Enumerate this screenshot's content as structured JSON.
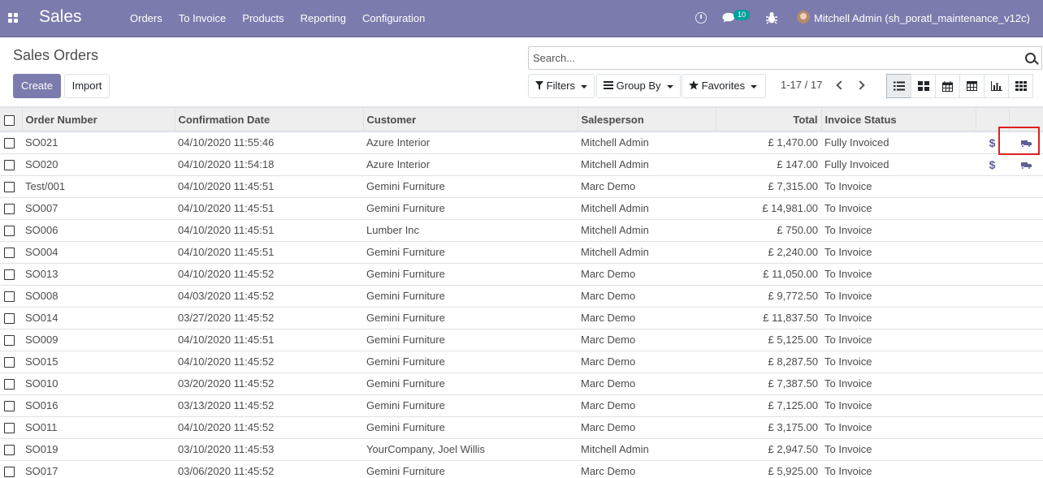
{
  "navbar": {
    "brand": "Sales",
    "menu": [
      "Orders",
      "To Invoice",
      "Products",
      "Reporting",
      "Configuration"
    ],
    "messages_count": "10",
    "user": "Mitchell Admin (sh_poratl_maintenance_v12c)"
  },
  "control_panel": {
    "title": "Sales Orders",
    "create_label": "Create",
    "import_label": "Import",
    "search_placeholder": "Search...",
    "filters_label": "Filters",
    "group_by_label": "Group By",
    "favorites_label": "Favorites",
    "pager": "1-17 / 17",
    "views": [
      "list-view-icon",
      "kanban-view-icon",
      "calendar-view-icon",
      "pivot-view-icon",
      "graph-view-icon",
      "activity-view-icon"
    ],
    "active_view": "list-view-icon"
  },
  "table": {
    "columns": [
      "Order Number",
      "Confirmation Date",
      "Customer",
      "Salesperson",
      "Total",
      "Invoice Status"
    ],
    "rows": [
      [
        "SO021",
        "04/10/2020 11:55:46",
        "Azure Interior",
        "Mitchell Admin",
        "£ 1,470.00",
        "Fully Invoiced"
      ],
      [
        "SO020",
        "04/10/2020 11:54:18",
        "Azure Interior",
        "Mitchell Admin",
        "£ 147.00",
        "Fully Invoiced"
      ],
      [
        "Test/001",
        "04/10/2020 11:45:51",
        "Gemini Furniture",
        "Marc Demo",
        "£ 7,315.00",
        "To Invoice"
      ],
      [
        "SO007",
        "04/10/2020 11:45:51",
        "Gemini Furniture",
        "Mitchell Admin",
        "£ 14,981.00",
        "To Invoice"
      ],
      [
        "SO006",
        "04/10/2020 11:45:51",
        "Lumber Inc",
        "Mitchell Admin",
        "£ 750.00",
        "To Invoice"
      ],
      [
        "SO004",
        "04/10/2020 11:45:51",
        "Gemini Furniture",
        "Mitchell Admin",
        "£ 2,240.00",
        "To Invoice"
      ],
      [
        "SO013",
        "04/10/2020 11:45:52",
        "Gemini Furniture",
        "Marc Demo",
        "£ 11,050.00",
        "To Invoice"
      ],
      [
        "SO008",
        "04/03/2020 11:45:52",
        "Gemini Furniture",
        "Marc Demo",
        "£ 9,772.50",
        "To Invoice"
      ],
      [
        "SO014",
        "03/27/2020 11:45:52",
        "Gemini Furniture",
        "Marc Demo",
        "£ 11,837.50",
        "To Invoice"
      ],
      [
        "SO009",
        "04/10/2020 11:45:51",
        "Gemini Furniture",
        "Marc Demo",
        "£ 5,125.00",
        "To Invoice"
      ],
      [
        "SO015",
        "04/10/2020 11:45:52",
        "Gemini Furniture",
        "Marc Demo",
        "£ 8,287.50",
        "To Invoice"
      ],
      [
        "SO010",
        "03/20/2020 11:45:52",
        "Gemini Furniture",
        "Marc Demo",
        "£ 7,387.50",
        "To Invoice"
      ],
      [
        "SO016",
        "03/13/2020 11:45:52",
        "Gemini Furniture",
        "Marc Demo",
        "£ 7,125.00",
        "To Invoice"
      ],
      [
        "SO011",
        "04/10/2020 11:45:52",
        "Gemini Furniture",
        "Marc Demo",
        "£ 3,175.00",
        "To Invoice"
      ],
      [
        "SO019",
        "03/10/2020 11:45:53",
        "YourCompany, Joel Willis",
        "Mitchell Admin",
        "£ 2,947.50",
        "To Invoice"
      ],
      [
        "SO017",
        "03/06/2020 11:45:52",
        "Gemini Furniture",
        "Marc Demo",
        "£ 5,925.00",
        "To Invoice"
      ]
    ],
    "row_icons": {
      "dollar_symbol": "$",
      "rows_with_icons": [
        0,
        1
      ],
      "icons": [
        "dollar-icon",
        "truck-icon"
      ]
    }
  },
  "colors": {
    "navbar": "#7c7bad",
    "primary_button": "#7c7bad",
    "icon_accent": "#5f5e97",
    "badge": "#00a09d",
    "highlight_box": "#e02020"
  }
}
